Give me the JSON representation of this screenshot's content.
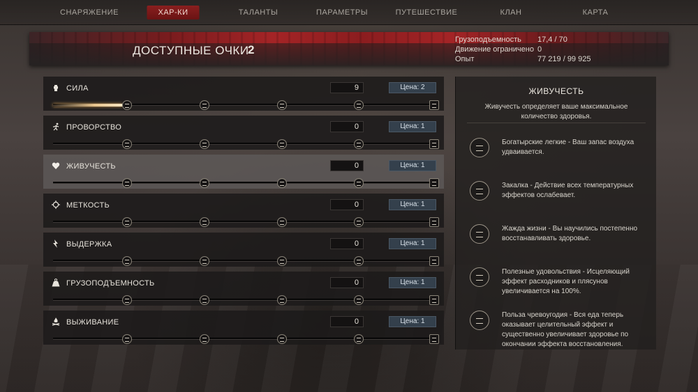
{
  "nav": {
    "tabs": [
      {
        "label": "СНАРЯЖЕНИЕ"
      },
      {
        "label": "ХАР-КИ"
      },
      {
        "label": "ТАЛАНТЫ"
      },
      {
        "label": "ПАРАМЕТРЫ"
      },
      {
        "label": "ПУТЕШЕСТВИЕ"
      },
      {
        "label": "КЛАН"
      },
      {
        "label": "КАРТА"
      }
    ],
    "active_tab": "ХАР-КИ"
  },
  "points": {
    "label": "ДОСТУПНЫЕ ОЧКИ",
    "value": "2"
  },
  "status": {
    "carry_label": "Грузоподъемность",
    "carry_value": "17,4 / 70",
    "move_label": "Движение ограничено",
    "move_value": "0",
    "xp_label": "Опыт",
    "xp_value": "77 219 / 99 925"
  },
  "attributes": [
    {
      "name": "СИЛА",
      "icon": "fist-icon",
      "value": "9",
      "cost": "Цена: 2",
      "progress": 0.18
    },
    {
      "name": "ПРОВОРСТВО",
      "icon": "runner-icon",
      "value": "0",
      "cost": "Цена: 1",
      "progress": 0
    },
    {
      "name": "ЖИВУЧЕСТЬ",
      "icon": "heart-icon",
      "value": "0",
      "cost": "Цена: 1",
      "progress": 0
    },
    {
      "name": "МЕТКОСТЬ",
      "icon": "crosshair-icon",
      "value": "0",
      "cost": "Цена: 1",
      "progress": 0
    },
    {
      "name": "ВЫДЕРЖКА",
      "icon": "lightning-icon",
      "value": "0",
      "cost": "Цена: 1",
      "progress": 0
    },
    {
      "name": "ГРУЗОПОДЪЕМНОСТЬ",
      "icon": "weight-icon",
      "value": "0",
      "cost": "Цена: 1",
      "progress": 0
    },
    {
      "name": "ВЫЖИВАНИЕ",
      "icon": "campfire-icon",
      "value": "0",
      "cost": "Цена: 1",
      "progress": 0
    }
  ],
  "selected_attribute": "ЖИВУЧЕСТЬ",
  "detail": {
    "title": "ЖИВУЧЕСТЬ",
    "description": "Живучесть определяет ваше максимальное количество здоровья.",
    "perks": [
      {
        "text": "Богатырские легкие - Ваш запас воздуха удваивается."
      },
      {
        "text": "Закалка - Действие всех температурных эффектов ослабевает."
      },
      {
        "text": "Жажда жизни - Вы научились постепенно восстанавливать здоровье."
      },
      {
        "text": "Полезные удовольствия - Исцеляющий эффект расходников и плясунов увеличивается на 100%."
      },
      {
        "text": "Польза чревоугодия - Вся еда теперь оказывает целительный эффект и существенно увеличивает здоровье по окончании эффекта восстановления."
      }
    ]
  },
  "colors": {
    "accent_red": "#8a1f1f",
    "cost_button": "#34404c",
    "progress_gold": "#e8c58e"
  }
}
